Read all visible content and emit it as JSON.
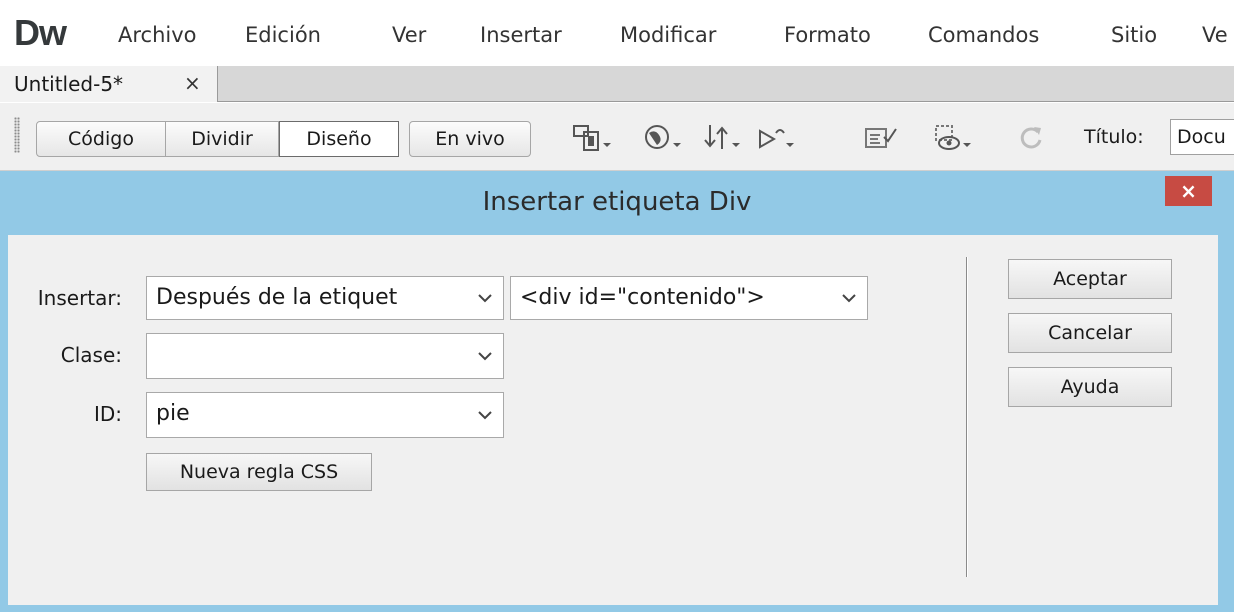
{
  "app": {
    "logo": "Dw"
  },
  "menu": {
    "items": [
      "Archivo",
      "Edición",
      "Ver",
      "Insertar",
      "Modificar",
      "Formato",
      "Comandos",
      "Sitio",
      "Ve"
    ]
  },
  "document_tab": {
    "label": "Untitled-5*",
    "close_glyph": "×"
  },
  "toolbar": {
    "view_buttons": [
      "Código",
      "Dividir",
      "Diseño",
      "En vivo"
    ],
    "active_view": "Diseño",
    "icons": [
      "multiscreen-icon",
      "preview-browser-icon",
      "file-transfer-icon",
      "debug-browser-icon",
      "validate-markup-icon",
      "visual-aids-icon",
      "refresh-icon"
    ],
    "title_label": "Título:",
    "title_value": "Docu"
  },
  "dialog": {
    "title": "Insertar etiqueta Div",
    "close_glyph": "×",
    "insert": {
      "label": "Insertar:",
      "position_value": "Después de la etiquet",
      "target_value": "<div id=\"contenido\">"
    },
    "class": {
      "label": "Clase:",
      "value": ""
    },
    "id": {
      "label": "ID:",
      "value": "pie"
    },
    "new_css_rule_label": "Nueva regla CSS",
    "buttons": {
      "ok": "Aceptar",
      "cancel": "Cancelar",
      "help": "Ayuda"
    }
  },
  "colors": {
    "dialog_frame": "#92c9e6",
    "dialog_body": "#f0f0f0",
    "close_button": "#c74b43",
    "toolbar": "#f0f0f0"
  }
}
